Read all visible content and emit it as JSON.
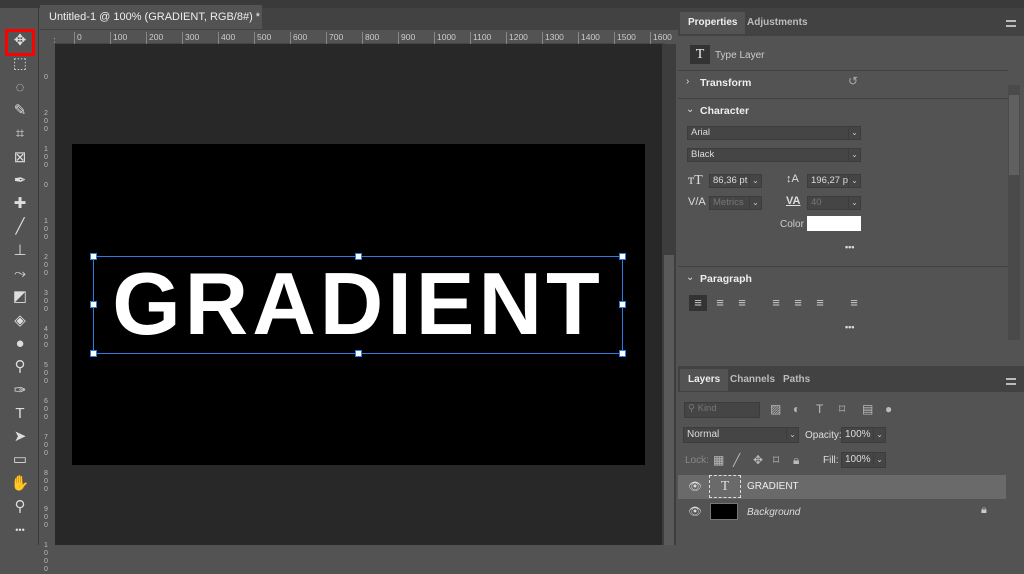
{
  "document": {
    "tab_title": "Untitled-1 @ 100% (GRADIENT, RGB/8#) *",
    "close": "×",
    "text": "GRADIENT"
  },
  "ruler": {
    "h": [
      "0",
      "100",
      "200",
      "300",
      "400",
      "500",
      "600",
      "700",
      "800",
      "900",
      "1000",
      "1100",
      "1200",
      "1300",
      "1400",
      "1500",
      "1600"
    ],
    "v": [
      "0",
      "200",
      "100",
      "0",
      "100",
      "200",
      "300",
      "400",
      "500",
      "600",
      "700",
      "800",
      "900",
      "1000"
    ]
  },
  "toolbar": {
    "tools": [
      "move",
      "marquee",
      "lasso",
      "quick-select",
      "crop",
      "frame",
      "eyedropper",
      "healing",
      "brush",
      "stamp",
      "history-brush",
      "eraser",
      "paint-bucket",
      "blur",
      "dodge",
      "pen",
      "type",
      "path-select",
      "rectangle",
      "hand",
      "zoom",
      "more"
    ],
    "highlight_color": "#ff0000"
  },
  "properties": {
    "tabs": [
      "Properties",
      "Adjustments"
    ],
    "layer_type": "Type Layer",
    "transform": "Transform",
    "character": "Character",
    "font": "Arial",
    "style": "Black",
    "size": "86,36 pt",
    "leading": "196,27 p",
    "kerning": "Metrics",
    "tracking": "40",
    "color_label": "Color",
    "color_value": "#ffffff",
    "more": "•••",
    "paragraph": "Paragraph"
  },
  "layers": {
    "tabs": [
      "Layers",
      "Channels",
      "Paths"
    ],
    "filter_placeholder": "Kind",
    "blend": "Normal",
    "opacity_label": "Opacity:",
    "opacity": "100%",
    "lock_label": "Lock:",
    "fill_label": "Fill:",
    "fill": "100%",
    "items": [
      {
        "name": "GRADIENT",
        "type": "text",
        "visible": true,
        "selected": true
      },
      {
        "name": "Background",
        "type": "fill",
        "visible": true,
        "locked": true
      }
    ]
  },
  "accent": "#2d7de0"
}
